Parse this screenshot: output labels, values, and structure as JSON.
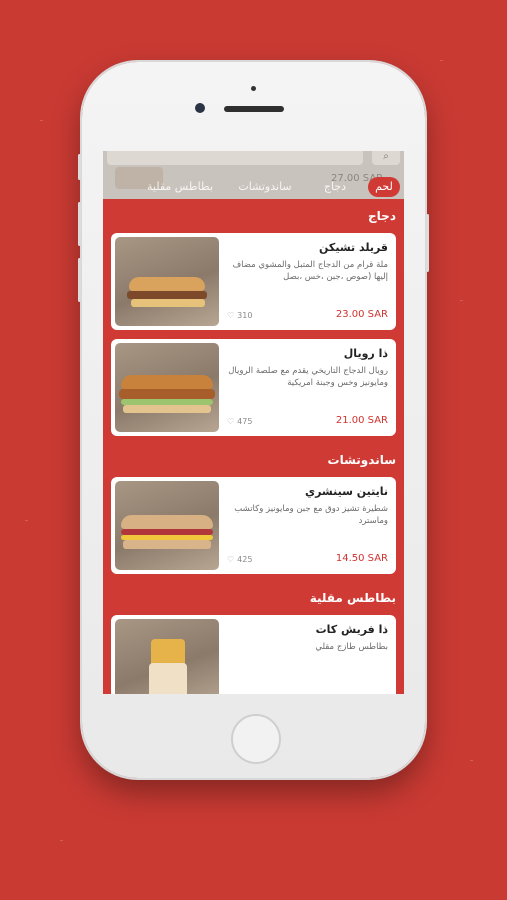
{
  "colors": {
    "background": "#c93a33",
    "accent": "#cf3a35",
    "price": "#d0322e"
  },
  "header": {
    "search_icon": "search-icon",
    "faded_price": "27.00 SAR",
    "tabs": [
      {
        "label": "لحم",
        "active": true
      },
      {
        "label": "دجاج",
        "active": false
      },
      {
        "label": "ساندوتشات",
        "active": false
      },
      {
        "label": "بطاطس مقلية",
        "active": false
      }
    ]
  },
  "sections": [
    {
      "title": "دجاج",
      "items": [
        {
          "name": "قريلد تشيكن",
          "description": "ملة قرام من الدجاج المتبل والمشوي مضاف إليها (صوص ،جبن ،خس ،بصل",
          "price": "23.00 SAR",
          "likes": "310"
        },
        {
          "name": "ذا رويال",
          "description": "رويال الدجاج التاريخي يقدم مع صلصة الرويال ومايونيز وخس وجبنة امريكية",
          "price": "21.00 SAR",
          "likes": "475"
        }
      ]
    },
    {
      "title": "ساندوتشات",
      "items": [
        {
          "name": "نايتين سينشري",
          "description": "شطيرة تشيز دوق مع جبن ومايونيز وكاتشب وماسترد",
          "price": "14.50 SAR",
          "likes": "425"
        }
      ]
    },
    {
      "title": "بطاطس مقلية",
      "items": [
        {
          "name": "ذا فريش كات",
          "description": "بطاطس طازج مقلي",
          "price": "",
          "likes": ""
        }
      ]
    }
  ]
}
